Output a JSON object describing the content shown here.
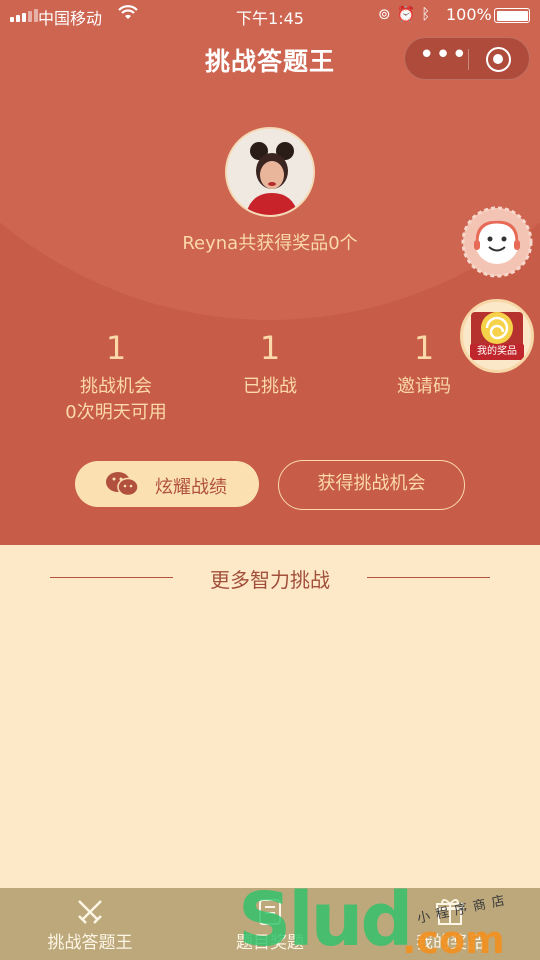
{
  "status_bar": {
    "carrier": "中国移动",
    "time": "下午1:45",
    "battery": "100%"
  },
  "nav": {
    "title": "挑战答题王",
    "more_label": "•••"
  },
  "profile": {
    "prize_summary": "Reyna共获得奖品0个"
  },
  "floating": {
    "prize_label": "我的奖品"
  },
  "stats": [
    {
      "value": "1",
      "label": "挑战机会",
      "sub": "0次明天可用"
    },
    {
      "value": "1",
      "label": "已挑战"
    },
    {
      "value": "1",
      "label": "邀请码"
    }
  ],
  "actions": {
    "share_label": "炫耀战绩",
    "get_chance_label": "获得挑战机会"
  },
  "more_section": {
    "title": "更多智力挑战"
  },
  "tabbar": {
    "items": [
      {
        "label": "挑战答题王",
        "icon": "crossed-swords-icon"
      },
      {
        "label": "题目奖题",
        "icon": "question-icon"
      },
      {
        "label": "我的奖品",
        "icon": "gift-icon"
      }
    ]
  },
  "watermark": {
    "main": "Slud",
    "suffix": ".com",
    "small": "小程序商店"
  },
  "colors": {
    "header": "#c75c48",
    "accent_text": "#fbd9a8",
    "page_bg": "#fde9c8",
    "tabbar": "#bda87b"
  }
}
